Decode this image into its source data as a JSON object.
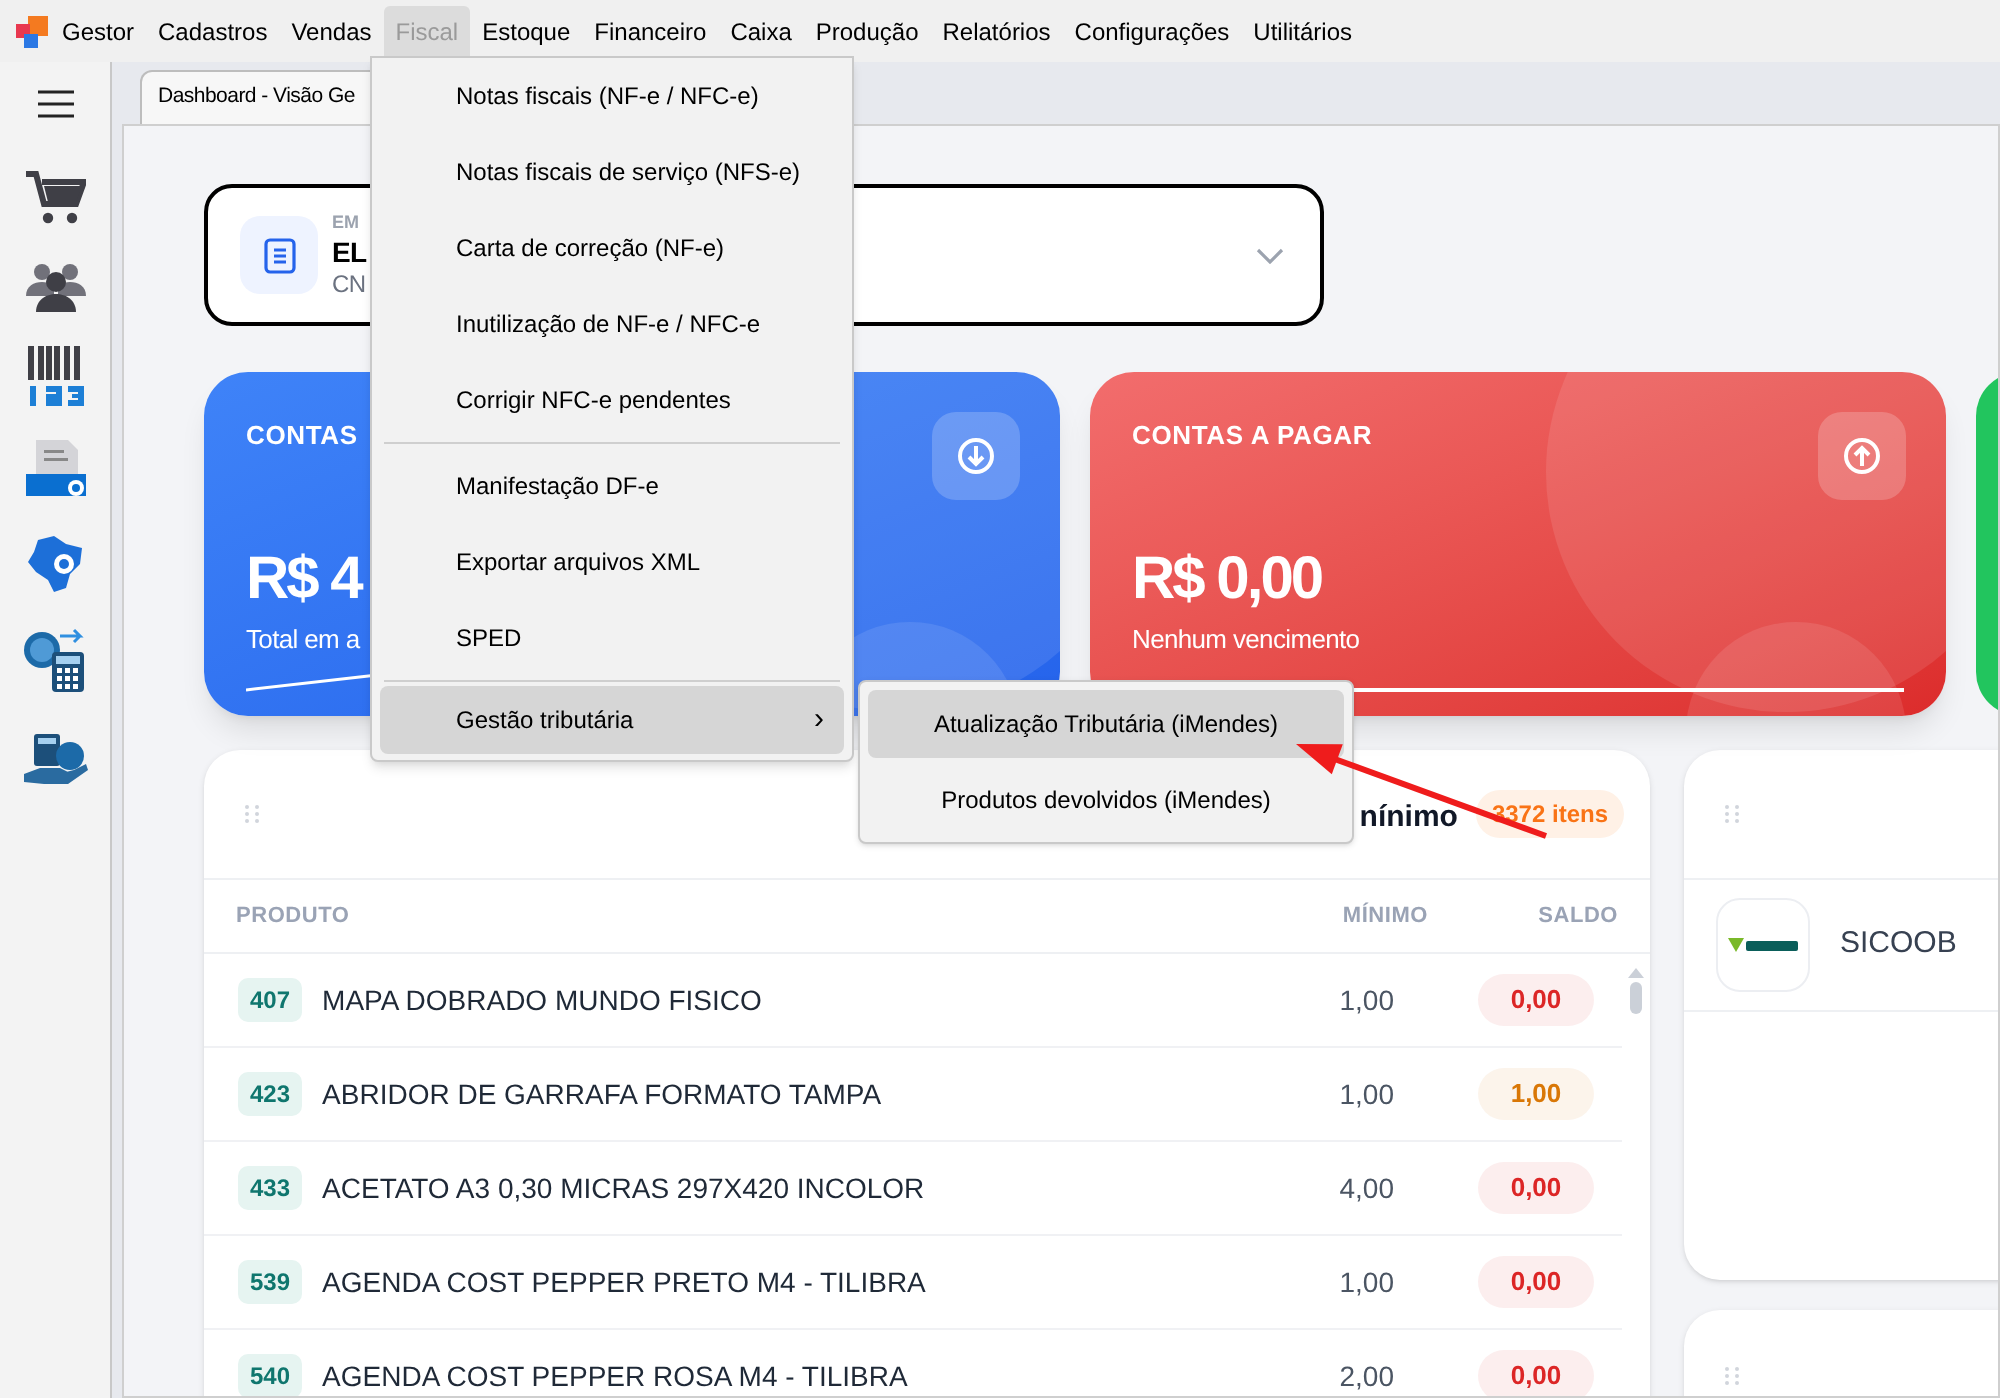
{
  "menubar": {
    "app_name": "Gestor",
    "items": [
      {
        "label": "Cadastros",
        "selected": false
      },
      {
        "label": "Vendas",
        "selected": false
      },
      {
        "label": "Fiscal",
        "selected": true
      },
      {
        "label": "Estoque",
        "selected": false
      },
      {
        "label": "Financeiro",
        "selected": false
      },
      {
        "label": "Caixa",
        "selected": false
      },
      {
        "label": "Produção",
        "selected": false
      },
      {
        "label": "Relatórios",
        "selected": false
      },
      {
        "label": "Configurações",
        "selected": false
      },
      {
        "label": "Utilitários",
        "selected": false
      }
    ]
  },
  "tabs": [
    {
      "label": "Dashboard - Visão Ge",
      "selected": true
    }
  ],
  "company": {
    "label": "EM",
    "name": "EL",
    "subtitle": "CN"
  },
  "cards": [
    {
      "kind": "receivable",
      "title": "CONTAS",
      "amount": "R$ 4",
      "caption": "Total em a"
    },
    {
      "kind": "payable",
      "title": "CONTAS A PAGAR",
      "amount": "R$ 0,00",
      "caption": "Nenhum vencimento"
    },
    {
      "kind": "stub"
    }
  ],
  "stock_panel": {
    "title": "nínimo",
    "count": "3372 itens",
    "columns": [
      "PRODUTO",
      "MÍNIMO",
      "SALDO"
    ],
    "rows": [
      {
        "code": "407",
        "name": "MAPA DOBRADO MUNDO FISICO",
        "minimum": "1,00",
        "balance": "0,00",
        "color": "#dc2626"
      },
      {
        "code": "423",
        "name": "ABRIDOR DE GARRAFA FORMATO TAMPA",
        "minimum": "1,00",
        "balance": "1,00",
        "color": "#d97706"
      },
      {
        "code": "433",
        "name": "ACETATO A3 0,30 MICRAS 297X420 INCOLOR",
        "minimum": "4,00",
        "balance": "0,00",
        "color": "#dc2626"
      },
      {
        "code": "539",
        "name": "AGENDA COST PEPPER PRETO M4 - TILIBRA",
        "minimum": "1,00",
        "balance": "0,00",
        "color": "#dc2626"
      },
      {
        "code": "540",
        "name": "AGENDA COST PEPPER ROSA M4 - TILIBRA",
        "minimum": "2,00",
        "balance": "0,00",
        "color": "#dc2626"
      }
    ]
  },
  "bank_panel": {
    "banks": [
      {
        "name": "SICOOB"
      }
    ]
  },
  "fiscal_menu": {
    "items": [
      {
        "kind": "item",
        "label": "Notas fiscais (NF-e / NFC-e)",
        "selected": false
      },
      {
        "kind": "item",
        "label": "Notas fiscais de serviço (NFS-e)",
        "selected": false
      },
      {
        "kind": "item",
        "label": "Carta de correção (NF-e)",
        "selected": false
      },
      {
        "kind": "item",
        "label": "Inutilização de NF-e / NFC-e",
        "selected": false
      },
      {
        "kind": "item",
        "label": "Corrigir NFC-e pendentes",
        "selected": false
      },
      {
        "kind": "separator"
      },
      {
        "kind": "item",
        "label": "Manifestação DF-e",
        "selected": false
      },
      {
        "kind": "item",
        "label": "Exportar arquivos XML",
        "selected": false
      },
      {
        "kind": "item",
        "label": "SPED",
        "selected": false
      },
      {
        "kind": "separator"
      },
      {
        "kind": "submenu",
        "label": "Gestão tributária",
        "caret": "›",
        "selected": true
      }
    ],
    "submenu": [
      {
        "label": "Atualização Tributária (iMendes)",
        "selected": true
      },
      {
        "label": "Produtos devolvidos (iMendes)",
        "selected": false
      }
    ]
  }
}
